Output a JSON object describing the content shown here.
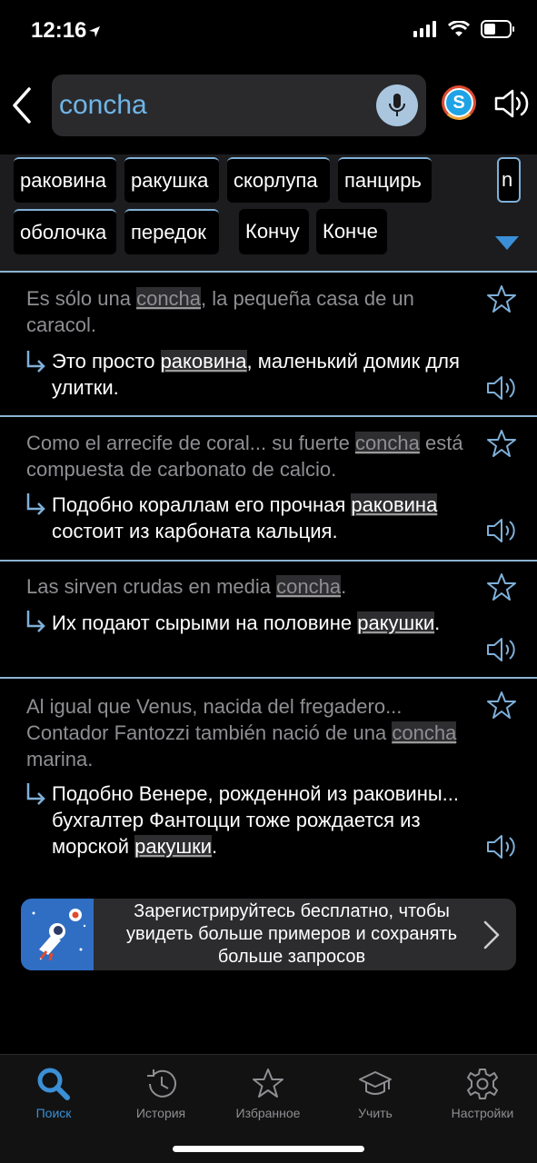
{
  "status": {
    "time": "12:16"
  },
  "search": {
    "query": "concha"
  },
  "translations": [
    "раковина",
    "ракушка",
    "скорлупа",
    "панцирь",
    "n",
    "оболочка",
    "передок",
    "Кончу",
    "Конче"
  ],
  "examples": [
    {
      "src_before": "Es sólo una ",
      "src_hl": "concha",
      "src_after": ", la pequeña casa de un caracol.",
      "tgt_before": "Это просто ",
      "tgt_hl": "раковина",
      "tgt_after": ", маленький домик для улитки."
    },
    {
      "src_before": "Como el arrecife de coral... su fuerte ",
      "src_hl": "concha",
      "src_after": " está compuesta de carbonato de calcio.",
      "tgt_before": "Подобно кораллам его прочная ",
      "tgt_hl": "раковина",
      "tgt_after": " состоит из карбоната кальция."
    },
    {
      "src_before": "Las sirven crudas en media ",
      "src_hl": "concha",
      "src_after": ".",
      "tgt_before": "Их подают сырыми на половине ",
      "tgt_hl": "ракушки",
      "tgt_after": "."
    },
    {
      "src_before": "Al igual que Venus, nacida del fregadero... Contador Fantozzi también nació de una ",
      "src_hl": "concha",
      "src_after": " marina.",
      "tgt_before": "Подобно Венере, рожденной из раковины... бухгалтер Фантоцци тоже рождается из морской ",
      "tgt_hl": "ракушки",
      "tgt_after": "."
    }
  ],
  "promo": {
    "text": "Зарегистрируйтесь бесплатно, чтобы увидеть больше примеров и сохранять больше запросов"
  },
  "tabs": {
    "search": "Поиск",
    "history": "История",
    "favorites": "Избранное",
    "learn": "Учить",
    "settings": "Настройки"
  },
  "colors": {
    "accent": "#3b8fd6",
    "query": "#6fb6e8",
    "divider": "#8cb3d4"
  },
  "icons": [
    "back-chevron-icon",
    "microphone-icon",
    "skype-icon",
    "speaker-icon",
    "star-icon",
    "arrow-turn-icon",
    "chevron-right-icon",
    "search-icon",
    "history-icon",
    "graduation-cap-icon",
    "gear-icon"
  ]
}
